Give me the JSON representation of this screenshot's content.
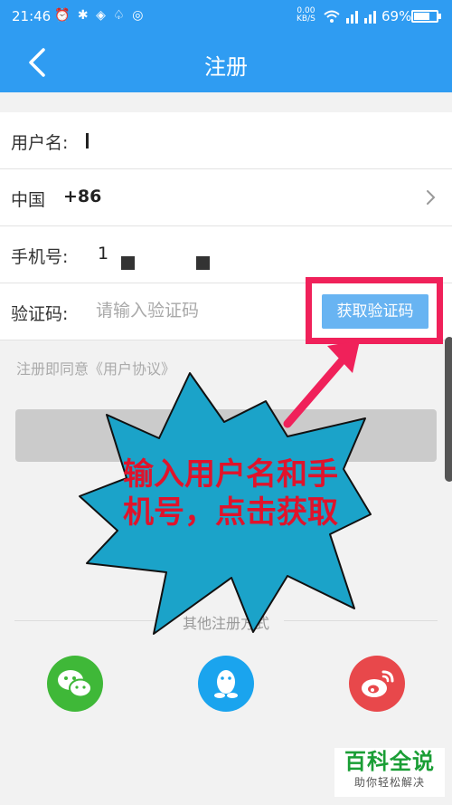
{
  "status_bar": {
    "time": "21:46",
    "net_speed_top": "0.00",
    "net_speed_bottom": "KB/S",
    "battery_text": "69%",
    "battery_level": 0.69
  },
  "header": {
    "title": "注册"
  },
  "form": {
    "username_label": "用户名:",
    "country_name": "中国",
    "country_code": "+86",
    "phone_label": "手机号:",
    "phone_digit": "1",
    "code_label": "验证码:",
    "code_placeholder": "请输入验证码",
    "get_code_label": "获取验证码"
  },
  "agreement_text": "注册即同意《用户协议》",
  "other_register_label": "其他注册方式",
  "annotation": {
    "line1": "输入用户名和手",
    "line2": "机号，点击获取"
  },
  "watermark": {
    "main": "百科全说",
    "sub": "助你轻松解决"
  },
  "colors": {
    "primary": "#2f9cf2",
    "button_blue": "#68b4f2",
    "highlight": "#f0215a",
    "burst": "#1ba3c9",
    "wechat": "#3fb838",
    "qq": "#1aa4ee",
    "weibo": "#e8484b"
  },
  "icons": [
    "chevron-left-icon",
    "chevron-right-icon",
    "wechat-icon",
    "qq-icon",
    "weibo-icon",
    "battery-icon",
    "wifi-icon",
    "signal-icon"
  ]
}
